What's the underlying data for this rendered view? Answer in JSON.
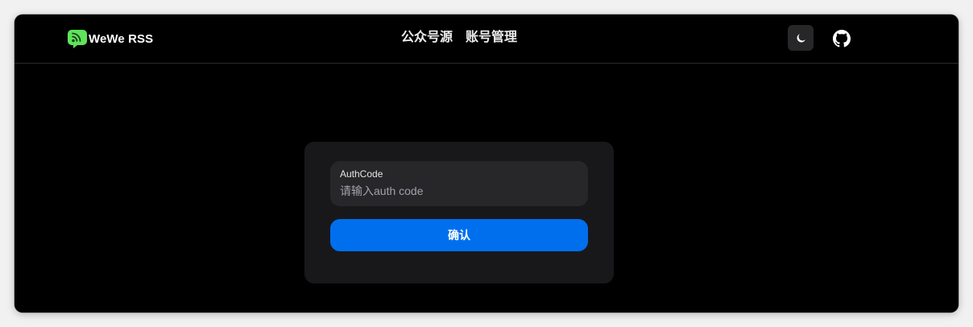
{
  "navbar": {
    "brand_name": "WeWe RSS",
    "logo_icon": "rss-chat-bubble-icon",
    "links": [
      "公众号源",
      "账号管理"
    ],
    "theme_icon": "moon-icon",
    "github_icon": "github-icon"
  },
  "login": {
    "label": "AuthCode",
    "placeholder": "请输入auth code",
    "value": "",
    "confirm_label": "确认"
  },
  "colors": {
    "background": "#000000",
    "card": "#18181b",
    "input": "#27272a",
    "primary": "#006fee",
    "logo_green": "#5ee35a"
  }
}
